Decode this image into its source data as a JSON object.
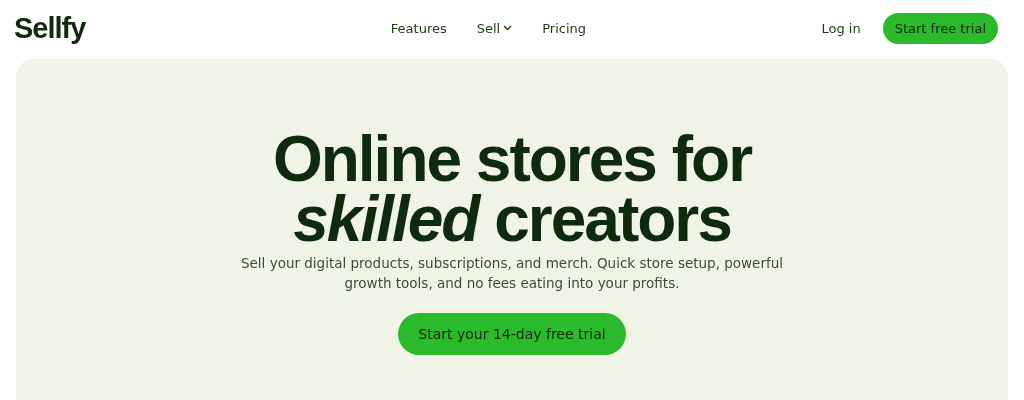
{
  "header": {
    "logo": "Sellfy",
    "nav": [
      {
        "label": "Features",
        "has_menu": false
      },
      {
        "label": "Sell",
        "has_menu": true
      },
      {
        "label": "Pricing",
        "has_menu": false
      }
    ],
    "login": "Log in",
    "cta": "Start free trial"
  },
  "hero": {
    "headline": "Online stores for *skilled* creators",
    "subtitle": "Sell your digital products, subscriptions, and merch. Quick store setup, powerful growth tools, and no fees eating into your profits.",
    "cta": "Start your 14-day free trial"
  }
}
